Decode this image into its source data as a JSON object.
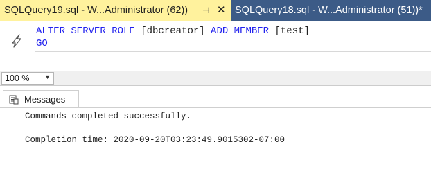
{
  "tabs": [
    {
      "title": "SQLQuery19.sql - W...Administrator (62))",
      "pin_glyph": "⊣",
      "close_glyph": "✕"
    },
    {
      "title": "SQLQuery18.sql - W...Administrator (51))*"
    }
  ],
  "editor": {
    "line1": {
      "kw1": "ALTER SERVER ROLE",
      "arg1": " [dbcreator] ",
      "kw2": "ADD",
      "kw3": "MEMBER",
      "arg2": " [test]"
    },
    "line2": "GO"
  },
  "zoom": {
    "value": "100 %"
  },
  "results": {
    "tab_label": "Messages",
    "messages": [
      "Commands completed successfully.",
      "",
      "Completion time: 2020-09-20T03:23:49.9015302-07:00"
    ]
  },
  "icons": {
    "gutter": "cursor-pointer-icon",
    "pin": "pin-icon",
    "close": "close-icon",
    "dropdown": "chevron-down-icon",
    "messages": "messages-icon"
  },
  "colors": {
    "tabbar_bg": "#2b3a57",
    "active_tab": "#fff29d",
    "inactive_tab": "#3c5b87",
    "keyword": "#2222ee"
  }
}
